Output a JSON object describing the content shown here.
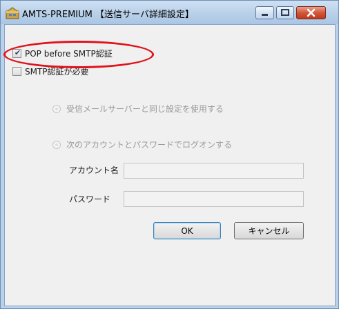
{
  "window": {
    "title": "AMTS-PREMIUM 【送信サーバ詳細設定】",
    "controls": {
      "minimize": "minimize-icon",
      "maximize": "maximize-icon",
      "close": "close-icon"
    }
  },
  "options": {
    "pop_before_smtp": {
      "label": "POP before SMTP認証",
      "checked": true
    },
    "smtp_auth_required": {
      "label": "SMTP認証が必要",
      "checked": false
    }
  },
  "auth_mode": {
    "same_as_incoming": {
      "label": "受信メールサーバーと同じ設定を使用する",
      "enabled": false
    },
    "logon_with_account": {
      "label": "次のアカウントとパスワードでログオンする",
      "enabled": false
    }
  },
  "fields": {
    "account": {
      "label": "アカウント名",
      "value": ""
    },
    "password": {
      "label": "パスワード",
      "value": ""
    }
  },
  "buttons": {
    "ok": "OK",
    "cancel": "キャンセル"
  },
  "annotation": {
    "color": "#e0131b"
  }
}
